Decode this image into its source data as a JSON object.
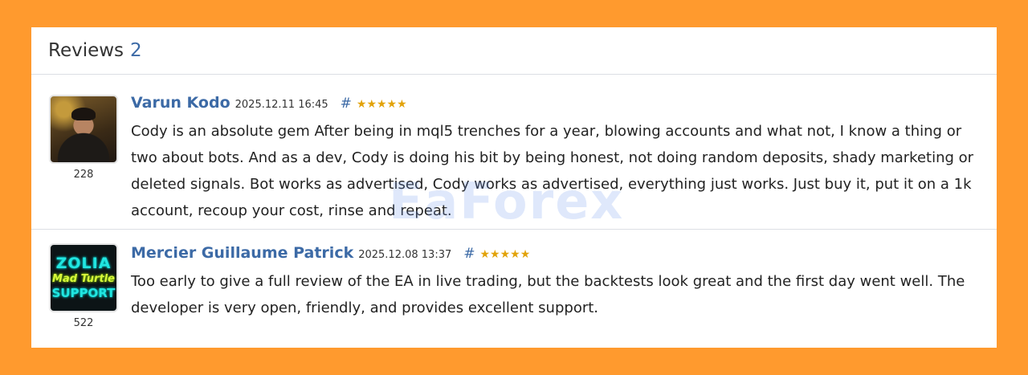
{
  "header": {
    "title": "Reviews",
    "count": "2"
  },
  "reviews": [
    {
      "author": "Varun Kodo",
      "date": "2025.12.11 16:45",
      "hash": "#",
      "stars": "★★★★★",
      "rating": 5,
      "rank": "228",
      "text": "Cody is an absolute gem After being in mql5 trenches for a year, blowing accounts and what not, I know a thing or two about bots. And as a dev, Cody is doing his bit by being honest, not doing random deposits, shady marketing or deleted signals. Bot works as advertised, Cody works as advertised, everything just works. Just buy it, put it on a 1k account, recoup your cost, rinse and repeat."
    },
    {
      "author": "Mercier Guillaume Patrick",
      "date": "2025.12.08 13:37",
      "hash": "#",
      "stars": "★★★★★",
      "rating": 5,
      "rank": "522",
      "avatar_lines": [
        "ZOLIA",
        "Mad Turtle",
        "SUPPORT"
      ],
      "text": "Too early to give a full review of the EA in live trading, but the backtests look great and the first day went well. The developer is very open, friendly, and provides excellent support."
    }
  ],
  "watermark": "EaForex",
  "colors": {
    "background": "#ff9a2e",
    "link": "#3c6aa6",
    "star": "#e2a30b"
  }
}
